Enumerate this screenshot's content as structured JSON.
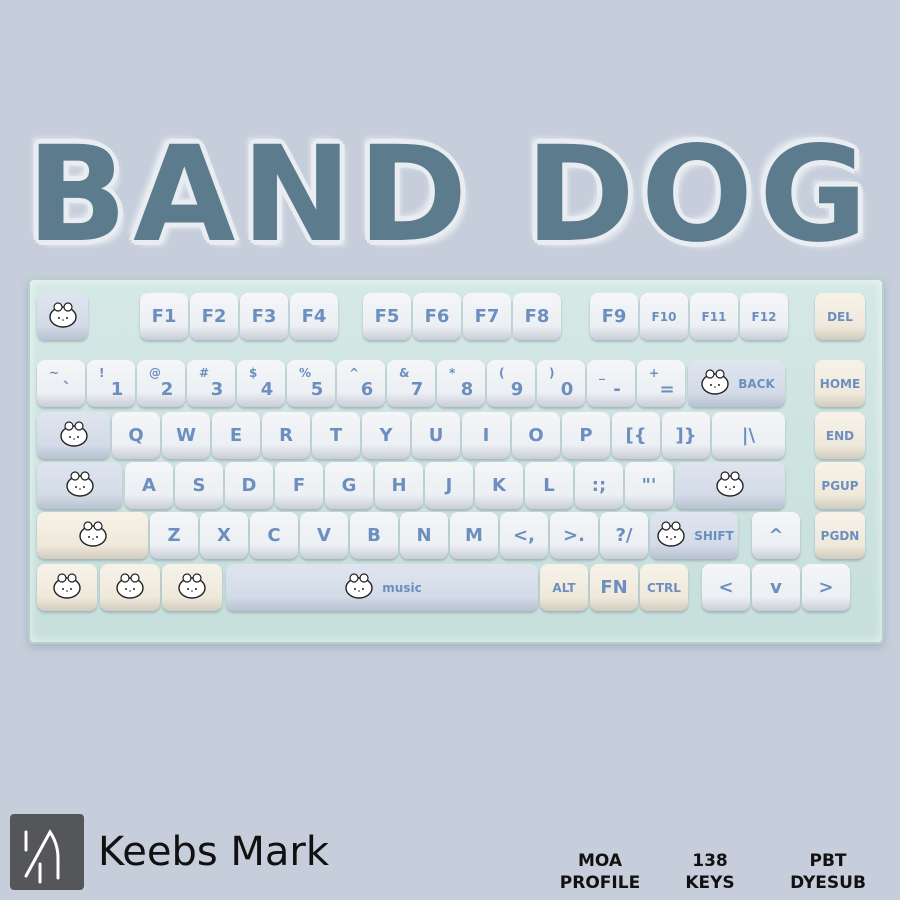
{
  "title": "BAND DOG",
  "brand": {
    "name": "Keebs Mark",
    "logo_icon": "keebs-mark-logo"
  },
  "specs": [
    {
      "line1": "MOA",
      "line2": "PROFILE"
    },
    {
      "line1": "138",
      "line2": "KEYS"
    },
    {
      "line1": "PBT",
      "line2": "DYESUB"
    }
  ],
  "colors": {
    "background": "#c6cedb",
    "title": "#5c7b8d",
    "legend": "#6c8fbf",
    "case": "#cfe3e0"
  },
  "keyboard": {
    "rows": [
      [
        {
          "l": "",
          "icon": "dog-face-icon"
        },
        {
          "l": "F1"
        },
        {
          "l": "F2"
        },
        {
          "l": "F3"
        },
        {
          "l": "F4"
        },
        {
          "l": "F5"
        },
        {
          "l": "F6"
        },
        {
          "l": "F7"
        },
        {
          "l": "F8"
        },
        {
          "l": "F9"
        },
        {
          "l": "F10"
        },
        {
          "l": "F11"
        },
        {
          "l": "F12"
        },
        {
          "l": "DEL"
        }
      ],
      [
        {
          "l": "`",
          "t": "~"
        },
        {
          "l": "1",
          "t": "!"
        },
        {
          "l": "2",
          "t": "@"
        },
        {
          "l": "3",
          "t": "#"
        },
        {
          "l": "4",
          "t": "$"
        },
        {
          "l": "5",
          "t": "%"
        },
        {
          "l": "6",
          "t": "^"
        },
        {
          "l": "7",
          "t": "&"
        },
        {
          "l": "8",
          "t": "*"
        },
        {
          "l": "9",
          "t": "("
        },
        {
          "l": "0",
          "t": ")"
        },
        {
          "l": "-",
          "t": "_"
        },
        {
          "l": "=",
          "t": "+"
        },
        {
          "l": "BACK",
          "icon": "frog-face-icon"
        },
        {
          "l": "HOME"
        }
      ],
      [
        {
          "l": "",
          "icon": "dog-face-icon"
        },
        {
          "l": "Q"
        },
        {
          "l": "W"
        },
        {
          "l": "E"
        },
        {
          "l": "R"
        },
        {
          "l": "T"
        },
        {
          "l": "Y"
        },
        {
          "l": "U"
        },
        {
          "l": "I"
        },
        {
          "l": "O"
        },
        {
          "l": "P"
        },
        {
          "l": "[{"
        },
        {
          "l": "]}"
        },
        {
          "l": "|\\"
        },
        {
          "l": "END"
        }
      ],
      [
        {
          "l": "",
          "icon": "dog-with-bow-icon"
        },
        {
          "l": "A"
        },
        {
          "l": "S"
        },
        {
          "l": "D"
        },
        {
          "l": "F"
        },
        {
          "l": "G"
        },
        {
          "l": "H"
        },
        {
          "l": "J"
        },
        {
          "l": "K"
        },
        {
          "l": "L"
        },
        {
          "l": ":;"
        },
        {
          "l": "\"'"
        },
        {
          "l": "",
          "icon": "dogs-playing-drums-icon"
        },
        {
          "l": "PGUP"
        }
      ],
      [
        {
          "l": "",
          "icon": "boombox-icon"
        },
        {
          "l": "Z"
        },
        {
          "l": "X"
        },
        {
          "l": "C"
        },
        {
          "l": "V"
        },
        {
          "l": "B"
        },
        {
          "l": "N"
        },
        {
          "l": "M"
        },
        {
          "l": "<,"
        },
        {
          "l": ">."
        },
        {
          "l": "?/"
        },
        {
          "l": "SHIFT",
          "icon": "guitar-icon"
        },
        {
          "l": "^"
        },
        {
          "l": "PGDN"
        }
      ],
      [
        {
          "l": "",
          "icon": "dog-face-icon"
        },
        {
          "l": "",
          "icon": "bunny-face-icon"
        },
        {
          "l": "",
          "icon": "dog-with-bow-icon"
        },
        {
          "l": "music",
          "icon": "music-notes-icon"
        },
        {
          "l": "ALT"
        },
        {
          "l": "FN"
        },
        {
          "l": "CTRL"
        },
        {
          "l": "<"
        },
        {
          "l": "v"
        },
        {
          "l": ">"
        }
      ]
    ]
  }
}
